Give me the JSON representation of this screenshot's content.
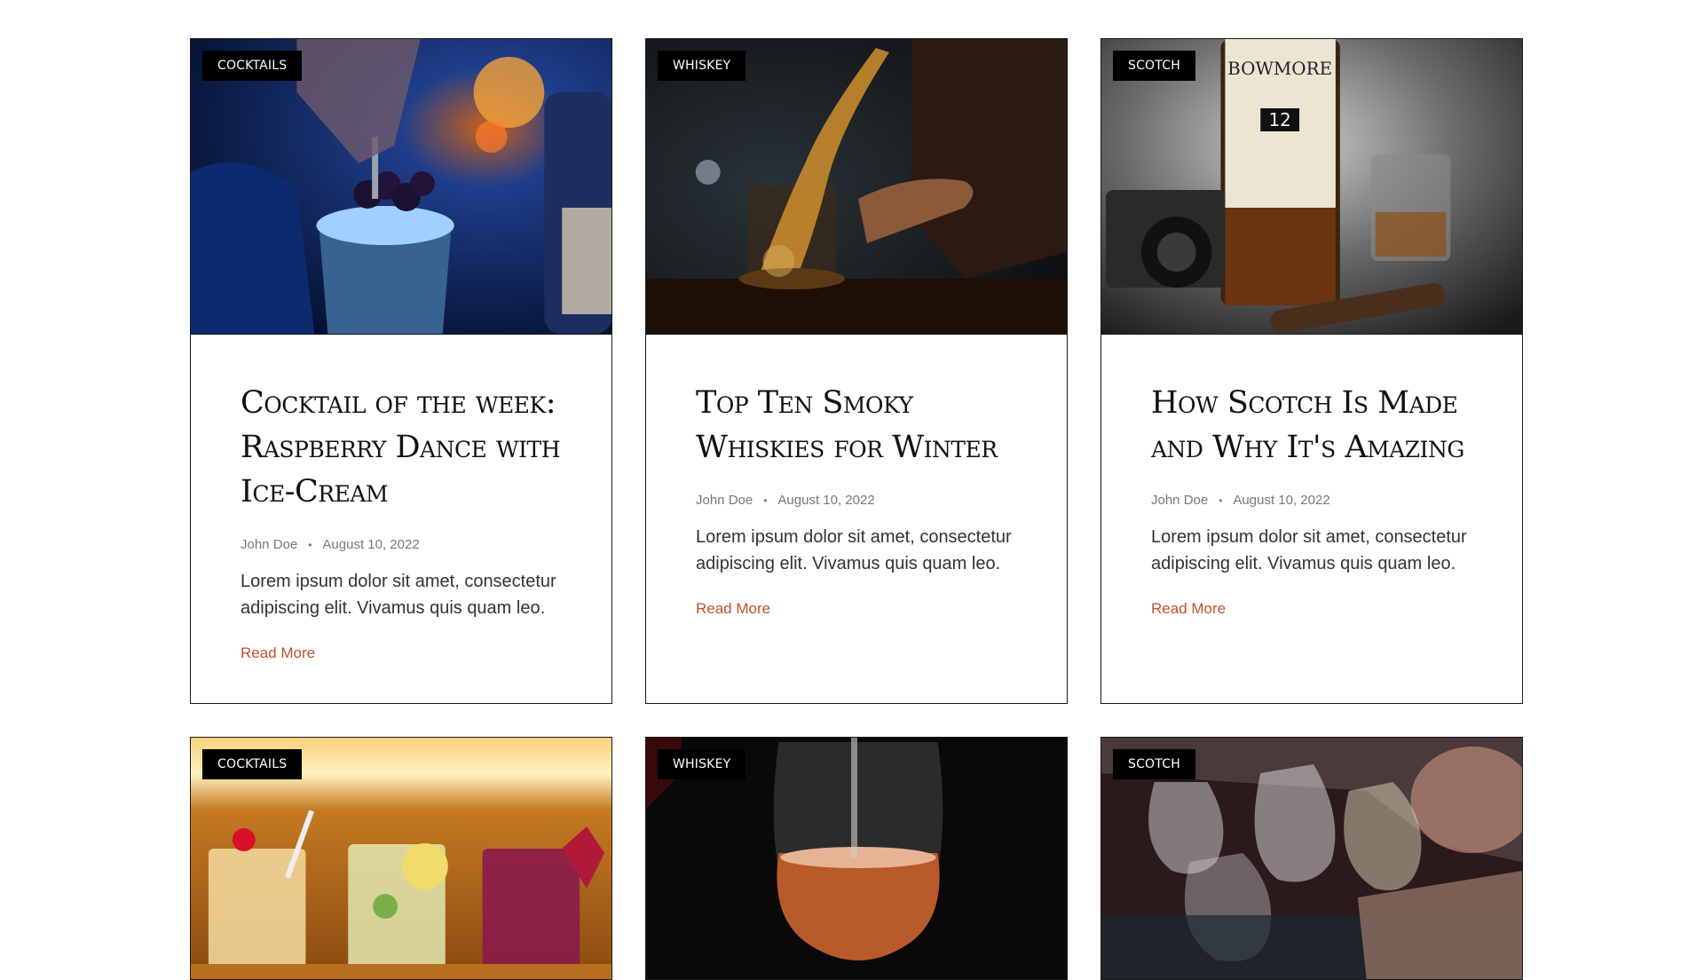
{
  "cards": [
    {
      "category": "COCKTAILS",
      "title": "Cocktail of the week: Raspberry Dance with Ice-Cream",
      "author": "John Doe",
      "date": "August 10, 2022",
      "excerpt": "Lorem ipsum dolor sit amet, consectetur adipiscing elit. Vivamus quis quam leo.",
      "link": "Read More",
      "image": "cocktail-blue-bar-photo"
    },
    {
      "category": "WHISKEY",
      "title": "Top Ten Smoky Whiskies for Winter",
      "author": "John Doe",
      "date": "August 10, 2022",
      "excerpt": "Lorem ipsum dolor sit amet, consectetur adipiscing elit. Vivamus quis quam leo.",
      "link": "Read More",
      "image": "whiskey-splash-photo"
    },
    {
      "category": "SCOTCH",
      "title": "How Scotch Is Made and Why It's Amazing",
      "author": "John Doe",
      "date": "August 10, 2022",
      "excerpt": "Lorem ipsum dolor sit amet, consectetur adipiscing elit. Vivamus quis quam leo.",
      "link": "Read More",
      "image": "bowmore-bottle-camera-photo",
      "image_text": {
        "brand": "BOWMORE",
        "age": "12"
      }
    },
    {
      "category": "COCKTAILS",
      "image": "three-cocktails-photo"
    },
    {
      "category": "WHISKEY",
      "image": "wine-glass-pour-photo"
    },
    {
      "category": "SCOTCH",
      "image": "toasting-glasses-photo"
    }
  ],
  "colors": {
    "accent": "#c0502b",
    "tag_bg": "#000000",
    "border": "#1a1a1a"
  }
}
